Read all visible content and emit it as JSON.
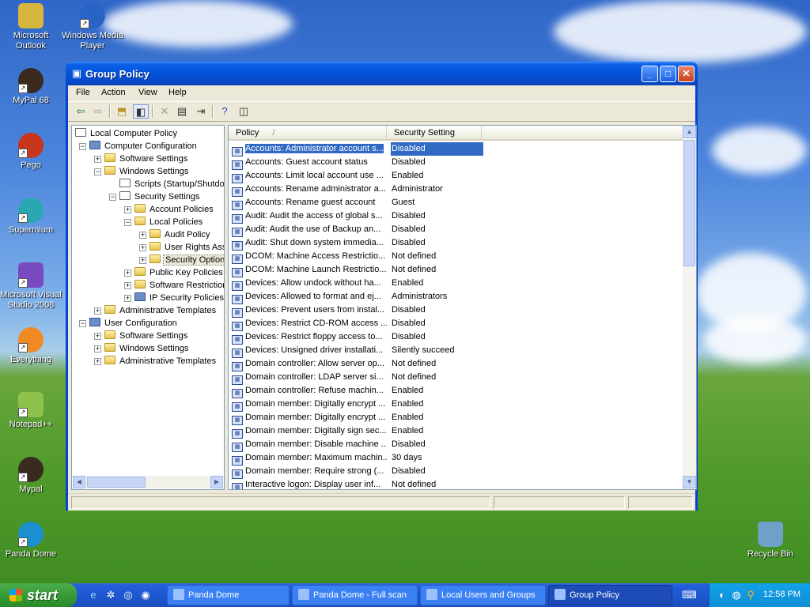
{
  "desktop": {
    "icons": [
      {
        "label": "Microsoft Outlook",
        "color": "#d7b640"
      },
      {
        "label": "Windows Media Player",
        "color": "#2a63c6"
      },
      {
        "label": "MyPal 68",
        "color": "#3a2a20"
      },
      {
        "label": "Pego",
        "color": "#c8341c"
      },
      {
        "label": "Supermium",
        "color": "#2aa7b0"
      },
      {
        "label": "Microsoft Visual Studio 2008",
        "color": "#7a4ac0"
      },
      {
        "label": "Everything",
        "color": "#f08a24"
      },
      {
        "label": "Notepad++",
        "color": "#8fc24a"
      },
      {
        "label": "Mypal",
        "color": "#3a2a20"
      },
      {
        "label": "Panda Dome",
        "color": "#1c8fd0"
      },
      {
        "label": "Recycle Bin",
        "color": "#6fa0c8"
      }
    ]
  },
  "window": {
    "title": "Group Policy",
    "menu": [
      "File",
      "Action",
      "View",
      "Help"
    ],
    "toolbar_icons": [
      "back-icon",
      "forward-icon",
      "up-folder-icon",
      "show-hide-tree-icon",
      "delete-icon",
      "properties-icon",
      "export-list-icon",
      "help-icon",
      "console-icon"
    ]
  },
  "tree": {
    "root": "Local Computer Policy",
    "computer_configuration": "Computer Configuration",
    "cc_software_settings": "Software Settings",
    "cc_windows_settings": "Windows Settings",
    "scripts": "Scripts (Startup/Shutdown)",
    "security_settings": "Security Settings",
    "account_policies": "Account Policies",
    "local_policies": "Local Policies",
    "audit_policy": "Audit Policy",
    "user_rights": "User Rights Assignment",
    "security_options": "Security Options",
    "public_key_policies": "Public Key Policies",
    "software_restriction": "Software Restriction Policies",
    "ip_security": "IP Security Policies",
    "cc_admin_templates": "Administrative Templates",
    "user_configuration": "User Configuration",
    "uc_software_settings": "Software Settings",
    "uc_windows_settings": "Windows Settings",
    "uc_admin_templates": "Administrative Templates"
  },
  "list": {
    "columns": {
      "policy": "Policy",
      "sort_indicator": "/",
      "setting": "Security Setting"
    },
    "rows": [
      {
        "policy": "Accounts: Administrator account s...",
        "setting": "Disabled"
      },
      {
        "policy": "Accounts: Guest account status",
        "setting": "Disabled"
      },
      {
        "policy": "Accounts: Limit local account use ...",
        "setting": "Enabled"
      },
      {
        "policy": "Accounts: Rename administrator a...",
        "setting": "Administrator"
      },
      {
        "policy": "Accounts: Rename guest account",
        "setting": "Guest"
      },
      {
        "policy": "Audit: Audit the access of global s...",
        "setting": "Disabled"
      },
      {
        "policy": "Audit: Audit the use of Backup an...",
        "setting": "Disabled"
      },
      {
        "policy": "Audit: Shut down system immedia...",
        "setting": "Disabled"
      },
      {
        "policy": "DCOM: Machine Access Restrictio...",
        "setting": "Not defined"
      },
      {
        "policy": "DCOM: Machine Launch Restrictio...",
        "setting": "Not defined"
      },
      {
        "policy": "Devices: Allow undock without ha...",
        "setting": "Enabled"
      },
      {
        "policy": "Devices: Allowed to format and ej...",
        "setting": "Administrators"
      },
      {
        "policy": "Devices: Prevent users from instal...",
        "setting": "Disabled"
      },
      {
        "policy": "Devices: Restrict CD-ROM access ...",
        "setting": "Disabled"
      },
      {
        "policy": "Devices: Restrict floppy access to...",
        "setting": "Disabled"
      },
      {
        "policy": "Devices: Unsigned driver installati...",
        "setting": "Silently succeed"
      },
      {
        "policy": "Domain controller: Allow server op...",
        "setting": "Not defined"
      },
      {
        "policy": "Domain controller: LDAP server si...",
        "setting": "Not defined"
      },
      {
        "policy": "Domain controller: Refuse machin...",
        "setting": "Enabled"
      },
      {
        "policy": "Domain member: Digitally encrypt ...",
        "setting": "Enabled"
      },
      {
        "policy": "Domain member: Digitally encrypt ...",
        "setting": "Enabled"
      },
      {
        "policy": "Domain member: Digitally sign sec...",
        "setting": "Enabled"
      },
      {
        "policy": "Domain member: Disable machine ...",
        "setting": "Disabled"
      },
      {
        "policy": "Domain member: Maximum machin...",
        "setting": "30 days"
      },
      {
        "policy": "Domain member: Require strong (...",
        "setting": "Disabled"
      },
      {
        "policy": "Interactive logon: Display user inf...",
        "setting": "Not defined"
      }
    ],
    "selected_index": 0
  },
  "taskbar": {
    "start_label": "start",
    "tasks": [
      "Panda Dome",
      "Panda Dome - Full scan",
      "Local Users and Groups",
      "Group Policy"
    ],
    "active_task": "Group Policy",
    "clock": "12:58 PM"
  },
  "colors": {
    "title_blue": "#0553d9",
    "selection": "#316ac5",
    "start_green": "#379b37"
  }
}
